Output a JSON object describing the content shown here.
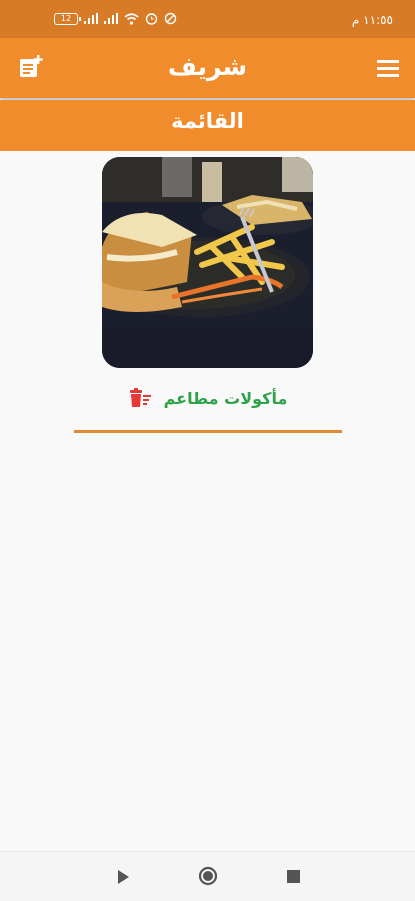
{
  "status_bar": {
    "time": "١١:٥٥ م",
    "battery": "12",
    "icons": [
      "signal-icon",
      "signal-icon",
      "wifi-icon",
      "alarm-icon",
      "do-not-disturb-icon"
    ]
  },
  "app_bar": {
    "title": "شريف",
    "left_icon": "add-note-icon",
    "right_icon": "menu-icon"
  },
  "sub_bar": {
    "title": "القائمة"
  },
  "list": {
    "items": [
      {
        "name": "مأكولات مطاعم",
        "image_icon": "food-photo",
        "action_icon": "delete-list-icon"
      }
    ]
  },
  "colors": {
    "primary": "#f08c2c",
    "status_bar": "#d77b27",
    "item_text": "#2fa24a",
    "delete": "#e53935",
    "divider": "#e08a35",
    "background": "#f9f9f9"
  },
  "nav_bar": {
    "icons": [
      "back-icon",
      "home-icon",
      "recents-icon"
    ]
  }
}
